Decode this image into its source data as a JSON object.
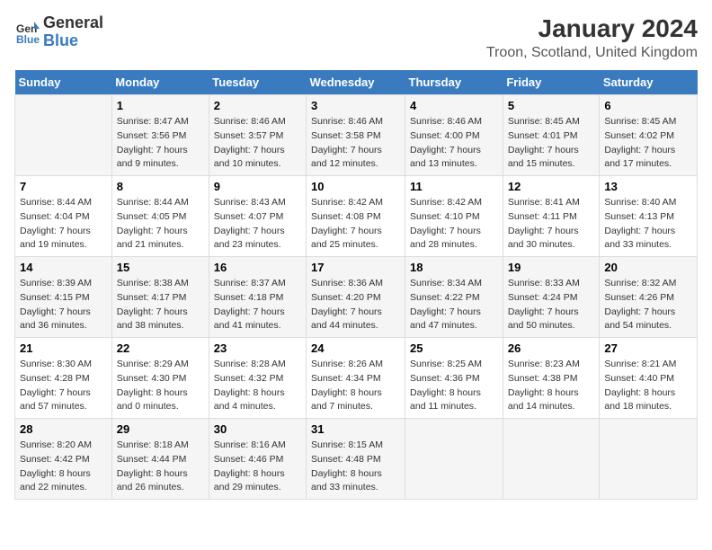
{
  "logo": {
    "text_general": "General",
    "text_blue": "Blue"
  },
  "title": "January 2024",
  "subtitle": "Troon, Scotland, United Kingdom",
  "days_header": [
    "Sunday",
    "Monday",
    "Tuesday",
    "Wednesday",
    "Thursday",
    "Friday",
    "Saturday"
  ],
  "weeks": [
    [
      {
        "day": "",
        "info": ""
      },
      {
        "day": "1",
        "info": "Sunrise: 8:47 AM\nSunset: 3:56 PM\nDaylight: 7 hours\nand 9 minutes."
      },
      {
        "day": "2",
        "info": "Sunrise: 8:46 AM\nSunset: 3:57 PM\nDaylight: 7 hours\nand 10 minutes."
      },
      {
        "day": "3",
        "info": "Sunrise: 8:46 AM\nSunset: 3:58 PM\nDaylight: 7 hours\nand 12 minutes."
      },
      {
        "day": "4",
        "info": "Sunrise: 8:46 AM\nSunset: 4:00 PM\nDaylight: 7 hours\nand 13 minutes."
      },
      {
        "day": "5",
        "info": "Sunrise: 8:45 AM\nSunset: 4:01 PM\nDaylight: 7 hours\nand 15 minutes."
      },
      {
        "day": "6",
        "info": "Sunrise: 8:45 AM\nSunset: 4:02 PM\nDaylight: 7 hours\nand 17 minutes."
      }
    ],
    [
      {
        "day": "7",
        "info": "Sunrise: 8:44 AM\nSunset: 4:04 PM\nDaylight: 7 hours\nand 19 minutes."
      },
      {
        "day": "8",
        "info": "Sunrise: 8:44 AM\nSunset: 4:05 PM\nDaylight: 7 hours\nand 21 minutes."
      },
      {
        "day": "9",
        "info": "Sunrise: 8:43 AM\nSunset: 4:07 PM\nDaylight: 7 hours\nand 23 minutes."
      },
      {
        "day": "10",
        "info": "Sunrise: 8:42 AM\nSunset: 4:08 PM\nDaylight: 7 hours\nand 25 minutes."
      },
      {
        "day": "11",
        "info": "Sunrise: 8:42 AM\nSunset: 4:10 PM\nDaylight: 7 hours\nand 28 minutes."
      },
      {
        "day": "12",
        "info": "Sunrise: 8:41 AM\nSunset: 4:11 PM\nDaylight: 7 hours\nand 30 minutes."
      },
      {
        "day": "13",
        "info": "Sunrise: 8:40 AM\nSunset: 4:13 PM\nDaylight: 7 hours\nand 33 minutes."
      }
    ],
    [
      {
        "day": "14",
        "info": "Sunrise: 8:39 AM\nSunset: 4:15 PM\nDaylight: 7 hours\nand 36 minutes."
      },
      {
        "day": "15",
        "info": "Sunrise: 8:38 AM\nSunset: 4:17 PM\nDaylight: 7 hours\nand 38 minutes."
      },
      {
        "day": "16",
        "info": "Sunrise: 8:37 AM\nSunset: 4:18 PM\nDaylight: 7 hours\nand 41 minutes."
      },
      {
        "day": "17",
        "info": "Sunrise: 8:36 AM\nSunset: 4:20 PM\nDaylight: 7 hours\nand 44 minutes."
      },
      {
        "day": "18",
        "info": "Sunrise: 8:34 AM\nSunset: 4:22 PM\nDaylight: 7 hours\nand 47 minutes."
      },
      {
        "day": "19",
        "info": "Sunrise: 8:33 AM\nSunset: 4:24 PM\nDaylight: 7 hours\nand 50 minutes."
      },
      {
        "day": "20",
        "info": "Sunrise: 8:32 AM\nSunset: 4:26 PM\nDaylight: 7 hours\nand 54 minutes."
      }
    ],
    [
      {
        "day": "21",
        "info": "Sunrise: 8:30 AM\nSunset: 4:28 PM\nDaylight: 7 hours\nand 57 minutes."
      },
      {
        "day": "22",
        "info": "Sunrise: 8:29 AM\nSunset: 4:30 PM\nDaylight: 8 hours\nand 0 minutes."
      },
      {
        "day": "23",
        "info": "Sunrise: 8:28 AM\nSunset: 4:32 PM\nDaylight: 8 hours\nand 4 minutes."
      },
      {
        "day": "24",
        "info": "Sunrise: 8:26 AM\nSunset: 4:34 PM\nDaylight: 8 hours\nand 7 minutes."
      },
      {
        "day": "25",
        "info": "Sunrise: 8:25 AM\nSunset: 4:36 PM\nDaylight: 8 hours\nand 11 minutes."
      },
      {
        "day": "26",
        "info": "Sunrise: 8:23 AM\nSunset: 4:38 PM\nDaylight: 8 hours\nand 14 minutes."
      },
      {
        "day": "27",
        "info": "Sunrise: 8:21 AM\nSunset: 4:40 PM\nDaylight: 8 hours\nand 18 minutes."
      }
    ],
    [
      {
        "day": "28",
        "info": "Sunrise: 8:20 AM\nSunset: 4:42 PM\nDaylight: 8 hours\nand 22 minutes."
      },
      {
        "day": "29",
        "info": "Sunrise: 8:18 AM\nSunset: 4:44 PM\nDaylight: 8 hours\nand 26 minutes."
      },
      {
        "day": "30",
        "info": "Sunrise: 8:16 AM\nSunset: 4:46 PM\nDaylight: 8 hours\nand 29 minutes."
      },
      {
        "day": "31",
        "info": "Sunrise: 8:15 AM\nSunset: 4:48 PM\nDaylight: 8 hours\nand 33 minutes."
      },
      {
        "day": "",
        "info": ""
      },
      {
        "day": "",
        "info": ""
      },
      {
        "day": "",
        "info": ""
      }
    ]
  ]
}
